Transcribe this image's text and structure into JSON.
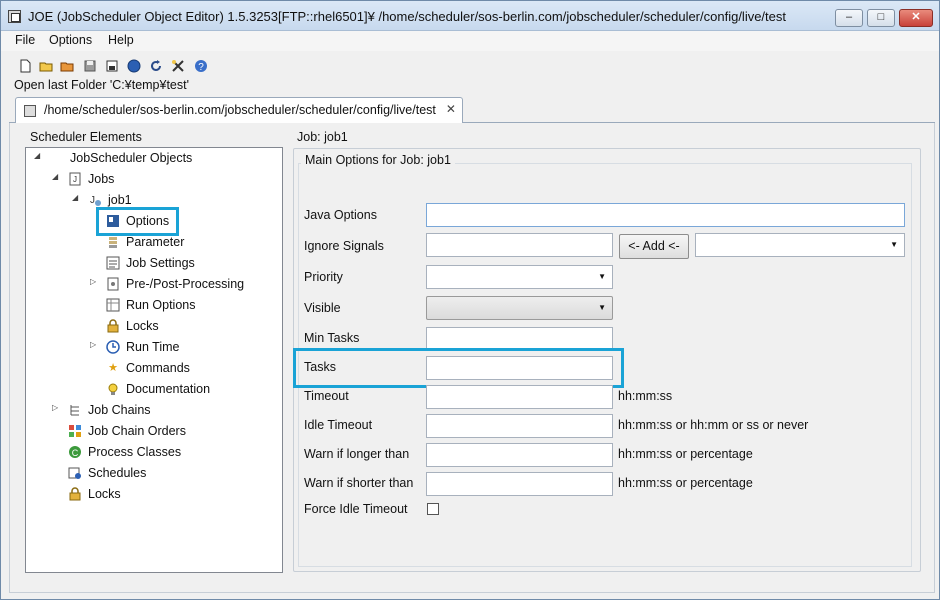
{
  "window": {
    "title": "JOE (JobScheduler Object Editor) 1.5.3253[FTP::rhel6501]¥ /home/scheduler/sos-berlin.com/jobscheduler/scheduler/config/live/test",
    "controls": {
      "minimize": "–",
      "maximize": "□",
      "close": "✕"
    }
  },
  "menu": [
    "File",
    "Options",
    "Help"
  ],
  "toolbar": {
    "icons": [
      "new-icon",
      "open-icon",
      "open-folder-icon",
      "save-icon",
      "save-as-icon",
      "web-icon",
      "reload-icon",
      "tools-icon",
      "help-icon"
    ]
  },
  "status": {
    "folder": "Open last Folder 'C:¥temp¥test'"
  },
  "tab": {
    "label": "/home/scheduler/sos-berlin.com/jobscheduler/scheduler/config/live/test",
    "close": "✕"
  },
  "sidebar": {
    "title": "Scheduler Elements",
    "tree": {
      "root": "JobScheduler Objects",
      "jobs": "Jobs",
      "job1": "job1",
      "options": "Options",
      "parameter": "Parameter",
      "job_settings": "Job Settings",
      "pre_post": "Pre-/Post-Processing",
      "run_options": "Run Options",
      "locks_child": "Locks",
      "run_time": "Run Time",
      "commands": "Commands",
      "documentation": "Documentation",
      "job_chains": "Job Chains",
      "job_chain_orders": "Job Chain Orders",
      "process_classes": "Process Classes",
      "schedules": "Schedules",
      "locks": "Locks"
    }
  },
  "main": {
    "job_label": "Job: job1",
    "group_title": "Main Options for Job: job1",
    "fields": {
      "java_options": {
        "label": "Java Options",
        "value": ""
      },
      "ignore_signals": {
        "label": "Ignore Signals",
        "value": "",
        "add_button": "<- Add <-",
        "select_value": ""
      },
      "priority": {
        "label": "Priority",
        "value": ""
      },
      "visible": {
        "label": "Visible",
        "value": ""
      },
      "min_tasks": {
        "label": "Min Tasks",
        "value": ""
      },
      "tasks": {
        "label": "Tasks",
        "value": ""
      },
      "timeout": {
        "label": "Timeout",
        "value": "",
        "hint": "hh:mm:ss"
      },
      "idle_timeout": {
        "label": "Idle Timeout",
        "value": "",
        "hint": "hh:mm:ss or hh:mm or ss or never"
      },
      "warn_longer": {
        "label": "Warn if longer than",
        "value": "",
        "hint": "hh:mm:ss or percentage"
      },
      "warn_shorter": {
        "label": "Warn if shorter than",
        "value": "",
        "hint": "hh:mm:ss or percentage"
      },
      "force_idle_timeout": {
        "label": "Force Idle Timeout",
        "checked": false
      }
    }
  },
  "colors": {
    "highlight": "#1aa3d6",
    "titlebar": "#c7d9ee",
    "close_button": "#c8423a"
  }
}
